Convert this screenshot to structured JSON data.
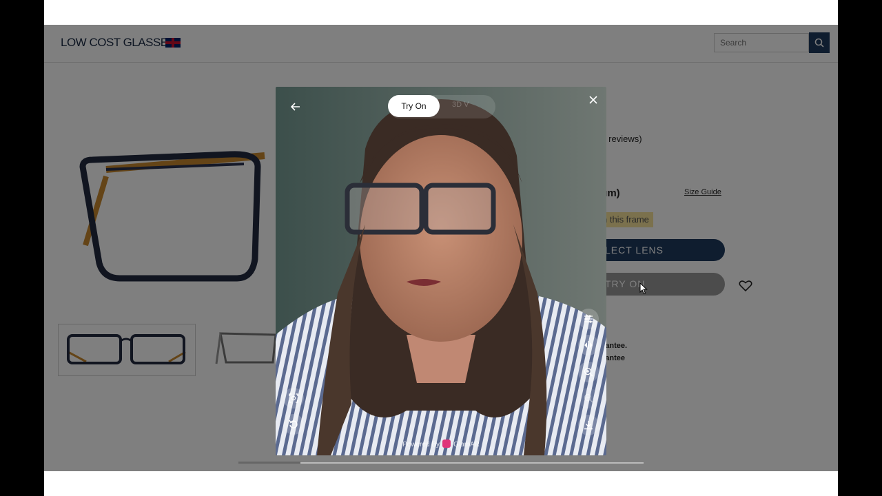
{
  "header": {
    "logo_text": "LOW COST GLASSES",
    "search_placeholder": "Search"
  },
  "product": {
    "reviews_text": "er reviews)",
    "size_text": "ium)",
    "size_guide_label": "Size Guide",
    "frame_tag": "n this frame",
    "select_lens_label": "LECT LENS",
    "try_on_label": "TRY ON",
    "guarantee_1": "rantee.",
    "guarantee_2": "rantee"
  },
  "modal": {
    "tab_try_on": "Try On",
    "tab_other": "3D V",
    "powered_by": "Powered By",
    "brand": "GlamAR"
  },
  "icons": [
    "back-arrow-icon",
    "close-icon",
    "sliders-icon",
    "mirror-icon",
    "zoom-in-icon",
    "zoom-out-icon",
    "download-icon",
    "face-scan-icon",
    "reset-icon",
    "search-icon",
    "heart-icon",
    "cursor-icon"
  ],
  "colors": {
    "brand_navy": "#1e3a5f",
    "frame_tag_bg": "#f7e39a",
    "glamar_pink": "#e0337a"
  }
}
